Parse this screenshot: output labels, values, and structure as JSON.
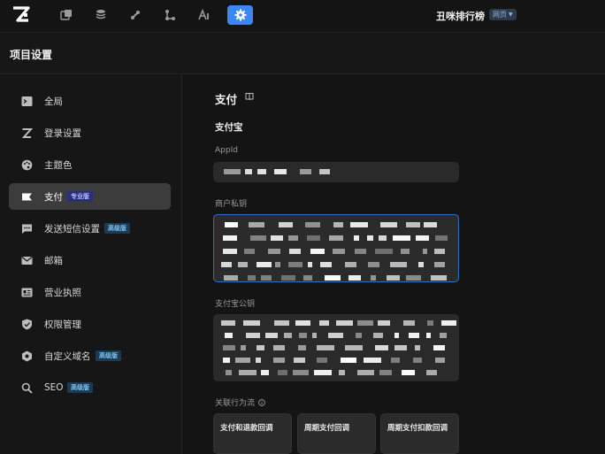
{
  "topbar": {
    "project_name": "丑咪排行榜",
    "platform_badge": "网页",
    "icons": [
      "logo-icon",
      "pages-icon",
      "database-icon",
      "plugin-icon",
      "workflow-icon",
      "ai-icon",
      "settings-icon"
    ],
    "active_icon": "settings-icon",
    "accent_color": "#3d87f5"
  },
  "header": {
    "title": "项目设置"
  },
  "sidebar": {
    "items": [
      {
        "label": "全局",
        "icon": "terminal-icon"
      },
      {
        "label": "登录设置",
        "icon": "login-icon"
      },
      {
        "label": "主题色",
        "icon": "palette-icon"
      },
      {
        "label": "支付",
        "icon": "payment-icon",
        "badge": "专业版",
        "active": true
      },
      {
        "label": "发送短信设置",
        "icon": "sms-icon",
        "badge": "高级版"
      },
      {
        "label": "邮箱",
        "icon": "mail-icon"
      },
      {
        "label": "营业执照",
        "icon": "license-icon"
      },
      {
        "label": "权限管理",
        "icon": "shield-icon"
      },
      {
        "label": "自定义域名",
        "icon": "domain-icon",
        "badge": "高级版"
      },
      {
        "label": "SEO",
        "icon": "search-icon",
        "badge": "高级版"
      }
    ]
  },
  "main": {
    "section_title": "支付",
    "subsection": "支付宝",
    "fields": {
      "appid_label": "AppId",
      "private_key_label": "商户私钥",
      "public_key_label": "支付宝公钥"
    },
    "related_label": "关联行为流",
    "cards": [
      "支付和退款回调",
      "周期支付回调",
      "周期支付扣款回调"
    ]
  }
}
